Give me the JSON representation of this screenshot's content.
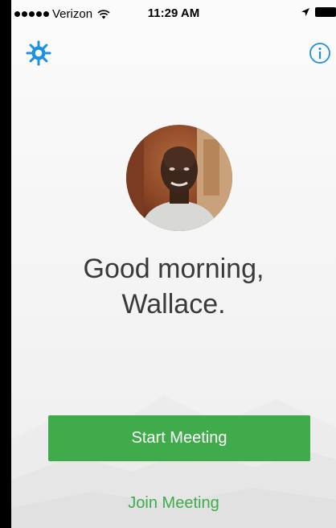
{
  "status_bar": {
    "carrier": "Verizon",
    "time": "11:29 AM"
  },
  "colors": {
    "accent_blue": "#1e90e0",
    "button_green": "#3fab4a",
    "text_dark": "#3a3a3a"
  },
  "icons": {
    "settings": "gear-icon",
    "info": "info-icon",
    "wifi": "wifi-icon",
    "location": "location-arrow-icon",
    "battery": "battery-icon"
  },
  "greeting": {
    "line1": "Good morning,",
    "line2": "Wallace."
  },
  "actions": {
    "start_meeting": "Start Meeting",
    "join_meeting": "Join Meeting"
  }
}
